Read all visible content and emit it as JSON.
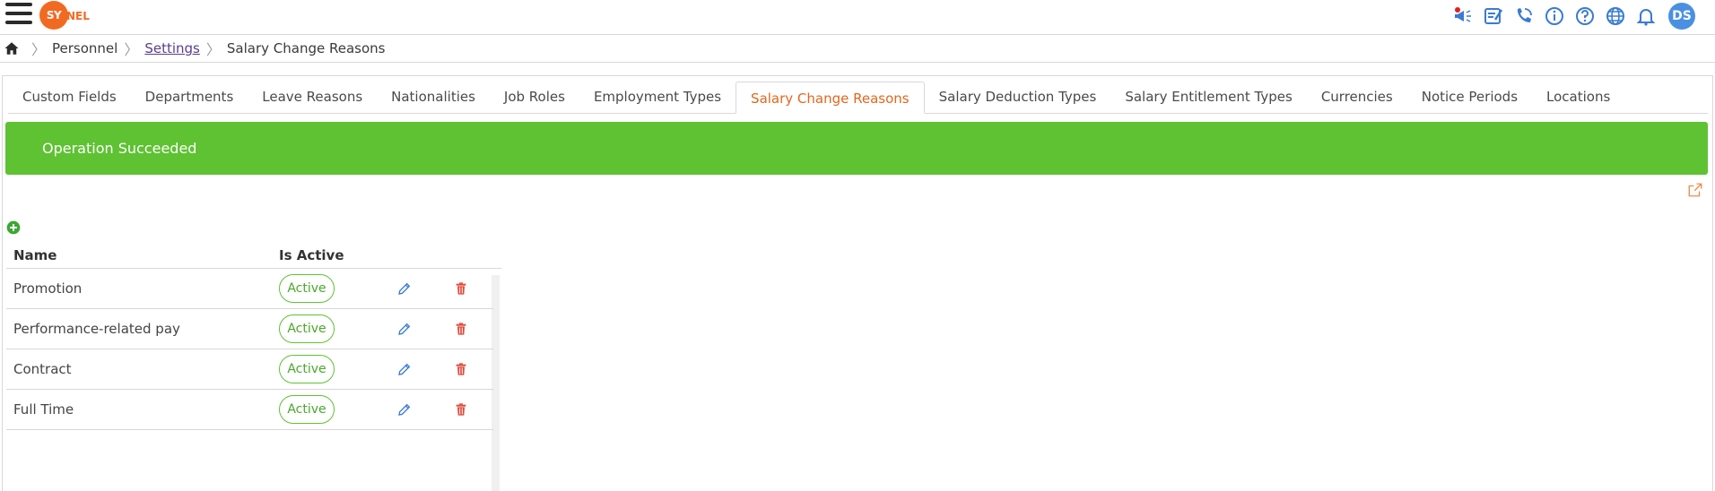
{
  "header": {
    "logo_text": "SY",
    "logo_tail": "NEL",
    "avatar_initials": "DS",
    "icons": [
      "megaphone-icon",
      "notes-icon",
      "phone-icon",
      "info-icon",
      "help-icon",
      "globe-icon",
      "bell-icon"
    ]
  },
  "breadcrumb": {
    "items": [
      "Personnel",
      "Settings",
      "Salary Change Reasons"
    ]
  },
  "tabs": [
    {
      "label": "Custom Fields"
    },
    {
      "label": "Departments"
    },
    {
      "label": "Leave Reasons"
    },
    {
      "label": "Nationalities"
    },
    {
      "label": "Job Roles"
    },
    {
      "label": "Employment Types"
    },
    {
      "label": "Salary Change Reasons"
    },
    {
      "label": "Salary Deduction Types"
    },
    {
      "label": "Salary Entitlement Types"
    },
    {
      "label": "Currencies"
    },
    {
      "label": "Notice Periods"
    },
    {
      "label": "Locations"
    }
  ],
  "alert": {
    "message": "Operation Succeeded"
  },
  "grid": {
    "columns": {
      "name": "Name",
      "is_active": "Is Active"
    },
    "rows": [
      {
        "name": "Promotion",
        "status": "Active"
      },
      {
        "name": "Performance-related pay",
        "status": "Active"
      },
      {
        "name": "Contract",
        "status": "Active"
      },
      {
        "name": "Full Time",
        "status": "Active"
      }
    ]
  },
  "colors": {
    "accent": "#e2671d",
    "success": "#5ec232",
    "avatar": "#4a90e2",
    "delete": "#e04a3a",
    "edit": "#3a7bd5"
  }
}
